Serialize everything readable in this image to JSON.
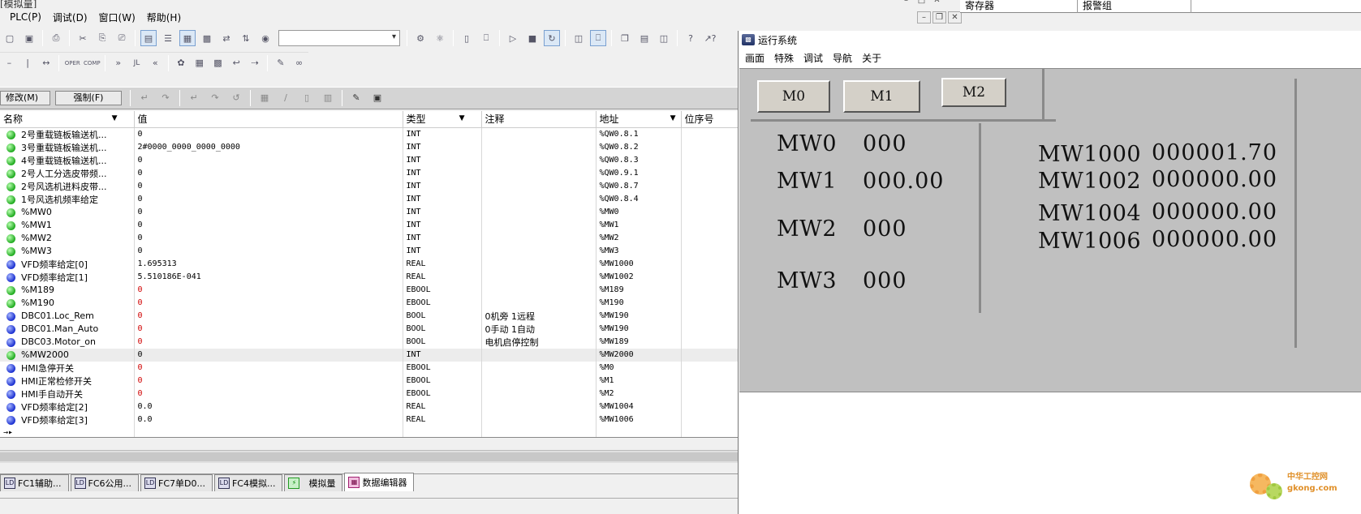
{
  "main_window": {
    "title_fragment": "[模拟量]",
    "menus": [
      "PLC(P)",
      "调试(D)",
      "窗口(W)",
      "帮助(H)"
    ],
    "search_value": "",
    "toolbar2_labels": [
      "OPER",
      "COMP",
      "JL"
    ],
    "modify_button": "修改(M)",
    "force_button": "强制(F)",
    "columns": {
      "name": "名称",
      "value": "值",
      "type": "类型",
      "comment": "注释",
      "address": "地址",
      "order": "位序号"
    },
    "rows": [
      {
        "name": "2号重载链板输送机...",
        "value": "0",
        "type": "INT",
        "comment": "",
        "address": "%QW0.8.1",
        "color": "green",
        "red": false
      },
      {
        "name": "3号重载链板输送机...",
        "value": "2#0000_0000_0000_0000",
        "type": "INT",
        "comment": "",
        "address": "%QW0.8.2",
        "color": "green",
        "red": false
      },
      {
        "name": "4号重载链板输送机...",
        "value": "0",
        "type": "INT",
        "comment": "",
        "address": "%QW0.8.3",
        "color": "green",
        "red": false
      },
      {
        "name": "2号人工分选皮带频...",
        "value": "0",
        "type": "INT",
        "comment": "",
        "address": "%QW0.9.1",
        "color": "green",
        "red": false
      },
      {
        "name": "2号风选机进料皮带...",
        "value": "0",
        "type": "INT",
        "comment": "",
        "address": "%QW0.8.7",
        "color": "green",
        "red": false
      },
      {
        "name": "1号风选机频率给定",
        "value": "0",
        "type": "INT",
        "comment": "",
        "address": "%QW0.8.4",
        "color": "green",
        "red": false
      },
      {
        "name": "%MW0",
        "value": "0",
        "type": "INT",
        "comment": "",
        "address": "%MW0",
        "color": "green",
        "red": false
      },
      {
        "name": "%MW1",
        "value": "0",
        "type": "INT",
        "comment": "",
        "address": "%MW1",
        "color": "green",
        "red": false
      },
      {
        "name": "%MW2",
        "value": "0",
        "type": "INT",
        "comment": "",
        "address": "%MW2",
        "color": "green",
        "red": false
      },
      {
        "name": "%MW3",
        "value": "0",
        "type": "INT",
        "comment": "",
        "address": "%MW3",
        "color": "green",
        "red": false
      },
      {
        "name": "VFD频率给定[0]",
        "value": "1.695313",
        "type": "REAL",
        "comment": "",
        "address": "%MW1000",
        "color": "blue",
        "red": false
      },
      {
        "name": "VFD频率给定[1]",
        "value": "5.510186E-041",
        "type": "REAL",
        "comment": "",
        "address": "%MW1002",
        "color": "blue",
        "red": false
      },
      {
        "name": "%M189",
        "value": "0",
        "type": "EBOOL",
        "comment": "",
        "address": "%M189",
        "color": "green",
        "red": true
      },
      {
        "name": "%M190",
        "value": "0",
        "type": "EBOOL",
        "comment": "",
        "address": "%M190",
        "color": "green",
        "red": true
      },
      {
        "name": "DBC01.Loc_Rem",
        "value": "0",
        "type": "BOOL",
        "comment": "0机旁 1远程",
        "address": "%MW190",
        "color": "blue",
        "red": true
      },
      {
        "name": "DBC01.Man_Auto",
        "value": "0",
        "type": "BOOL",
        "comment": "0手动 1自动",
        "address": "%MW190",
        "color": "blue",
        "red": true
      },
      {
        "name": "DBC03.Motor_on",
        "value": "0",
        "type": "BOOL",
        "comment": "电机启停控制",
        "address": "%MW189",
        "color": "blue",
        "red": true
      },
      {
        "name": "%MW2000",
        "value": "0",
        "type": "INT",
        "comment": "",
        "address": "%MW2000",
        "color": "green",
        "red": false
      },
      {
        "name": "HMI急停开关",
        "value": "0",
        "type": "EBOOL",
        "comment": "",
        "address": "%M0",
        "color": "blue",
        "red": true
      },
      {
        "name": "HMI正常检修开关",
        "value": "0",
        "type": "EBOOL",
        "comment": "",
        "address": "%M1",
        "color": "blue",
        "red": true
      },
      {
        "name": "HMI手自动开关",
        "value": "0",
        "type": "EBOOL",
        "comment": "",
        "address": "%M2",
        "color": "blue",
        "red": true
      },
      {
        "name": "VFD频率给定[2]",
        "value": "0.0",
        "type": "REAL",
        "comment": "",
        "address": "%MW1004",
        "color": "blue",
        "red": false
      },
      {
        "name": "VFD频率给定[3]",
        "value": "0.0",
        "type": "REAL",
        "comment": "",
        "address": "%MW1006",
        "color": "blue",
        "red": false
      }
    ],
    "tabs": [
      "FC1辅助...",
      "FC6公用...",
      "FC7单D0...",
      "FC4模拟...",
      "模拟量",
      "数据编辑器"
    ]
  },
  "right_pane_headers": [
    "寄存器",
    "报警组"
  ],
  "runtime_window": {
    "title": "运行系统",
    "menus": [
      "画面",
      "特殊",
      "调试",
      "导航",
      "关于"
    ],
    "buttons": [
      "M0",
      "M1",
      "M2"
    ],
    "registers_left": [
      {
        "label": "MW0",
        "value": "000"
      },
      {
        "label": "MW1",
        "value": "000.00"
      },
      {
        "label": "MW2",
        "value": "000"
      },
      {
        "label": "MW3",
        "value": "000"
      }
    ],
    "registers_right": [
      {
        "label": "MW1000",
        "value": "000001.70"
      },
      {
        "label": "MW1002",
        "value": "000000.00"
      },
      {
        "label": "MW1004",
        "value": "000000.00"
      },
      {
        "label": "MW1006",
        "value": "000000.00"
      }
    ]
  },
  "watermark": "中华工控网 gkong.com",
  "colors": {
    "status_green": "#1faa1f",
    "status_blue": "#1a2fd0",
    "red_value": "#d00000",
    "hmi_bg": "#c0c0c0"
  }
}
